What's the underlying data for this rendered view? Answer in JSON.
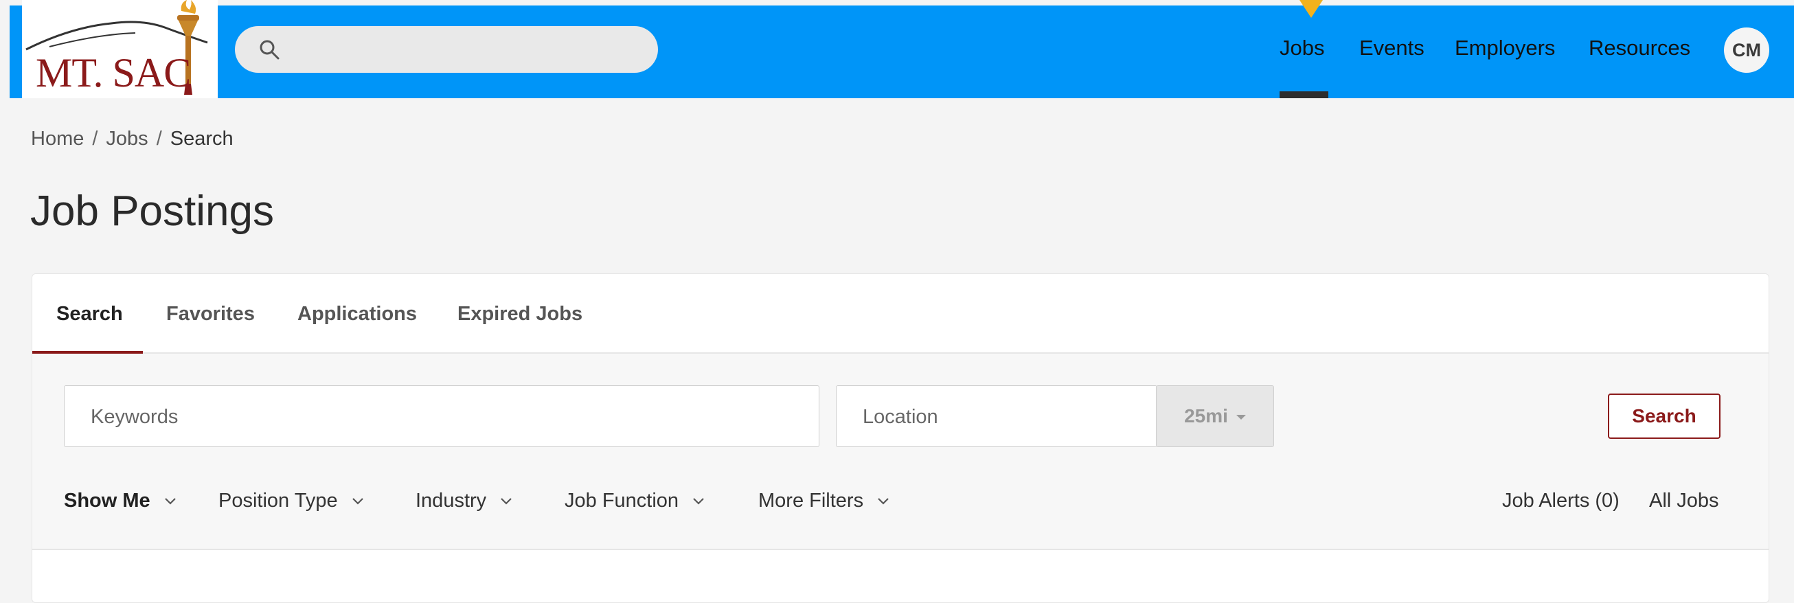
{
  "header": {
    "logo_text": "MT. SAC",
    "search_placeholder": "",
    "nav": [
      {
        "label": "Jobs"
      },
      {
        "label": "Events"
      },
      {
        "label": "Employers"
      },
      {
        "label": "Resources"
      }
    ],
    "active_nav": "Jobs",
    "avatar_initials": "CM",
    "colors": {
      "bar": "#0095f8",
      "marker": "#f2b21c",
      "brand": "#8b1a1a"
    }
  },
  "breadcrumb": {
    "items": [
      "Home",
      "Jobs",
      "Search"
    ],
    "separator": "/"
  },
  "page": {
    "title": "Job Postings"
  },
  "tabs": [
    {
      "label": "Search"
    },
    {
      "label": "Favorites"
    },
    {
      "label": "Applications"
    },
    {
      "label": "Expired Jobs"
    }
  ],
  "active_tab": "Search",
  "search": {
    "keywords_placeholder": "Keywords",
    "keywords_value": "",
    "location_placeholder": "Location",
    "location_value": "",
    "radius": "25mi",
    "button_label": "Search"
  },
  "filters": {
    "items": [
      {
        "label": "Show Me"
      },
      {
        "label": "Position Type"
      },
      {
        "label": "Industry"
      },
      {
        "label": "Job Function"
      },
      {
        "label": "More Filters"
      }
    ],
    "job_alerts": "Job Alerts (0)",
    "all_jobs": "All Jobs"
  },
  "icons": {
    "search": "search-icon",
    "chevron": "chevron-down-icon",
    "caret": "caret-down-icon",
    "torch": "torch-logo-icon"
  }
}
